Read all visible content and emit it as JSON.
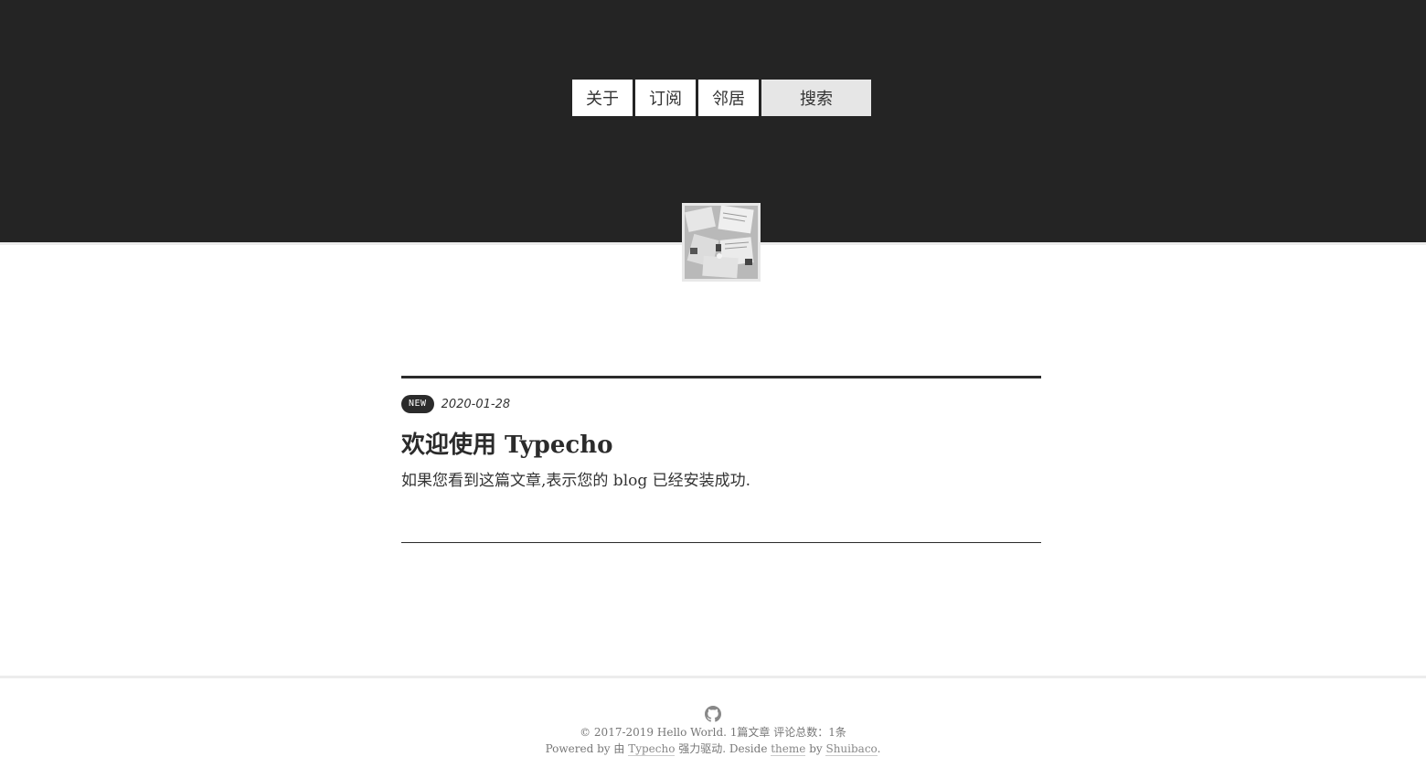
{
  "nav": {
    "items": [
      {
        "label": "关于"
      },
      {
        "label": "订阅"
      },
      {
        "label": "邻居"
      }
    ],
    "search_label": "搜索"
  },
  "post": {
    "badge": "NEW",
    "date": "2020-01-28",
    "title": "欢迎使用 Typecho",
    "excerpt": "如果您看到这篇文章,表示您的 blog 已经安装成功."
  },
  "footer": {
    "copyright": "© 2017-2019 Hello World. 1篇文章 评论总数：1条",
    "powered_prefix": "Powered by 由 ",
    "typecho_link": "Typecho",
    "powered_mid": " 强力驱动. Deside ",
    "theme_link": "theme",
    "by_text": " by ",
    "author_link": "Shuibaco",
    "end": "."
  },
  "colors": {
    "header_bg": "#242424",
    "nav_bg": "#ffffff",
    "search_bg": "#e6e6e6",
    "badge_bg": "#2b2b2b"
  }
}
